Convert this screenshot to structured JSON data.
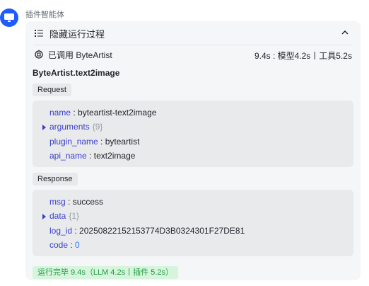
{
  "agent": {
    "name": "插件智能体"
  },
  "panel": {
    "title": "隐藏运行过程",
    "status_label": "已调用 ByteArtist",
    "timing": "9.4s : 模型4.2s丨工具5.2s"
  },
  "tool": {
    "name": "ByteArtist.text2image",
    "request_label": "Request",
    "request": {
      "name_key": "name",
      "name_value": "byteartist-text2image",
      "arguments_key": "arguments",
      "arguments_count": "{9}",
      "plugin_name_key": "plugin_name",
      "plugin_name_value": "byteartist",
      "api_name_key": "api_name",
      "api_name_value": "text2image"
    },
    "response_label": "Response",
    "response": {
      "msg_key": "msg",
      "msg_value": "success",
      "data_key": "data",
      "data_count": "{1}",
      "log_id_key": "log_id",
      "log_id_value": "20250822152153774D3B0324301F27DE81",
      "code_key": "code",
      "code_value": "0"
    }
  },
  "footer": {
    "done_label": "运行完毕 9.4s（LLM 4.2s丨插件 5.2s）"
  },
  "colors": {
    "accent": "#1f5bff",
    "key": "#3b3fc8",
    "success_bg": "#d6f5dc",
    "success_text": "#1c9b40"
  }
}
